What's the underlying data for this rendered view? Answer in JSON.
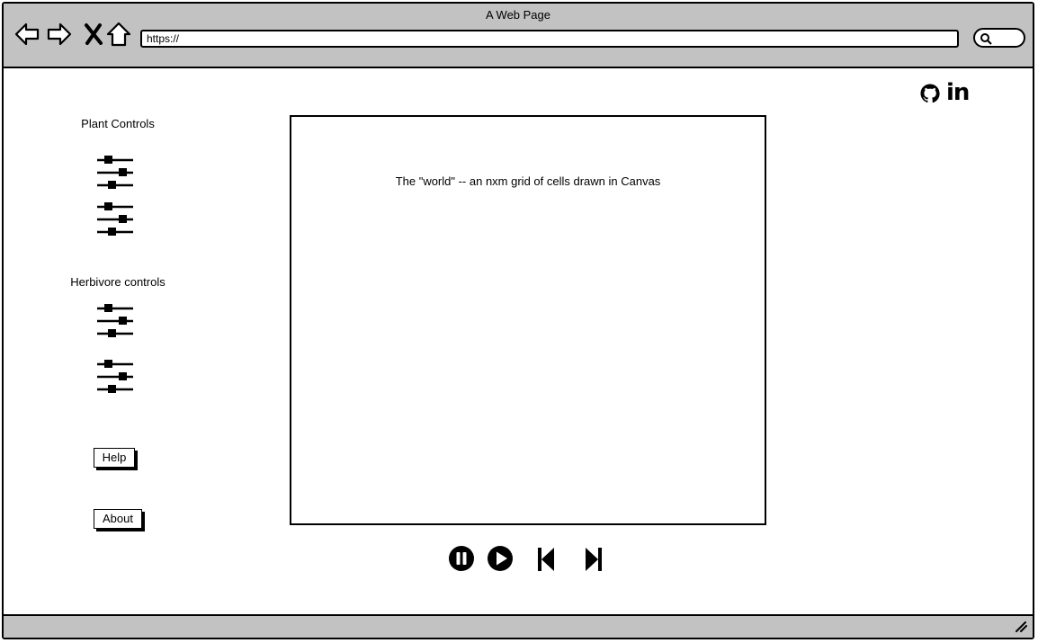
{
  "window": {
    "title": "A Web Page",
    "url": "https://"
  },
  "sidebar": {
    "plant_title": "Plant Controls",
    "herbivore_title": "Herbivore controls",
    "help_label": "Help",
    "about_label": "About"
  },
  "main": {
    "canvas_label": "The \"world\" -- an nxm grid of cells drawn in Canvas"
  },
  "playback": {
    "icons": [
      "pause-icon",
      "play-icon",
      "skip-back-icon",
      "skip-forward-icon"
    ]
  },
  "header": {
    "social_icons": [
      "github-icon",
      "linkedin-icon"
    ],
    "linkedin_text": "in"
  }
}
